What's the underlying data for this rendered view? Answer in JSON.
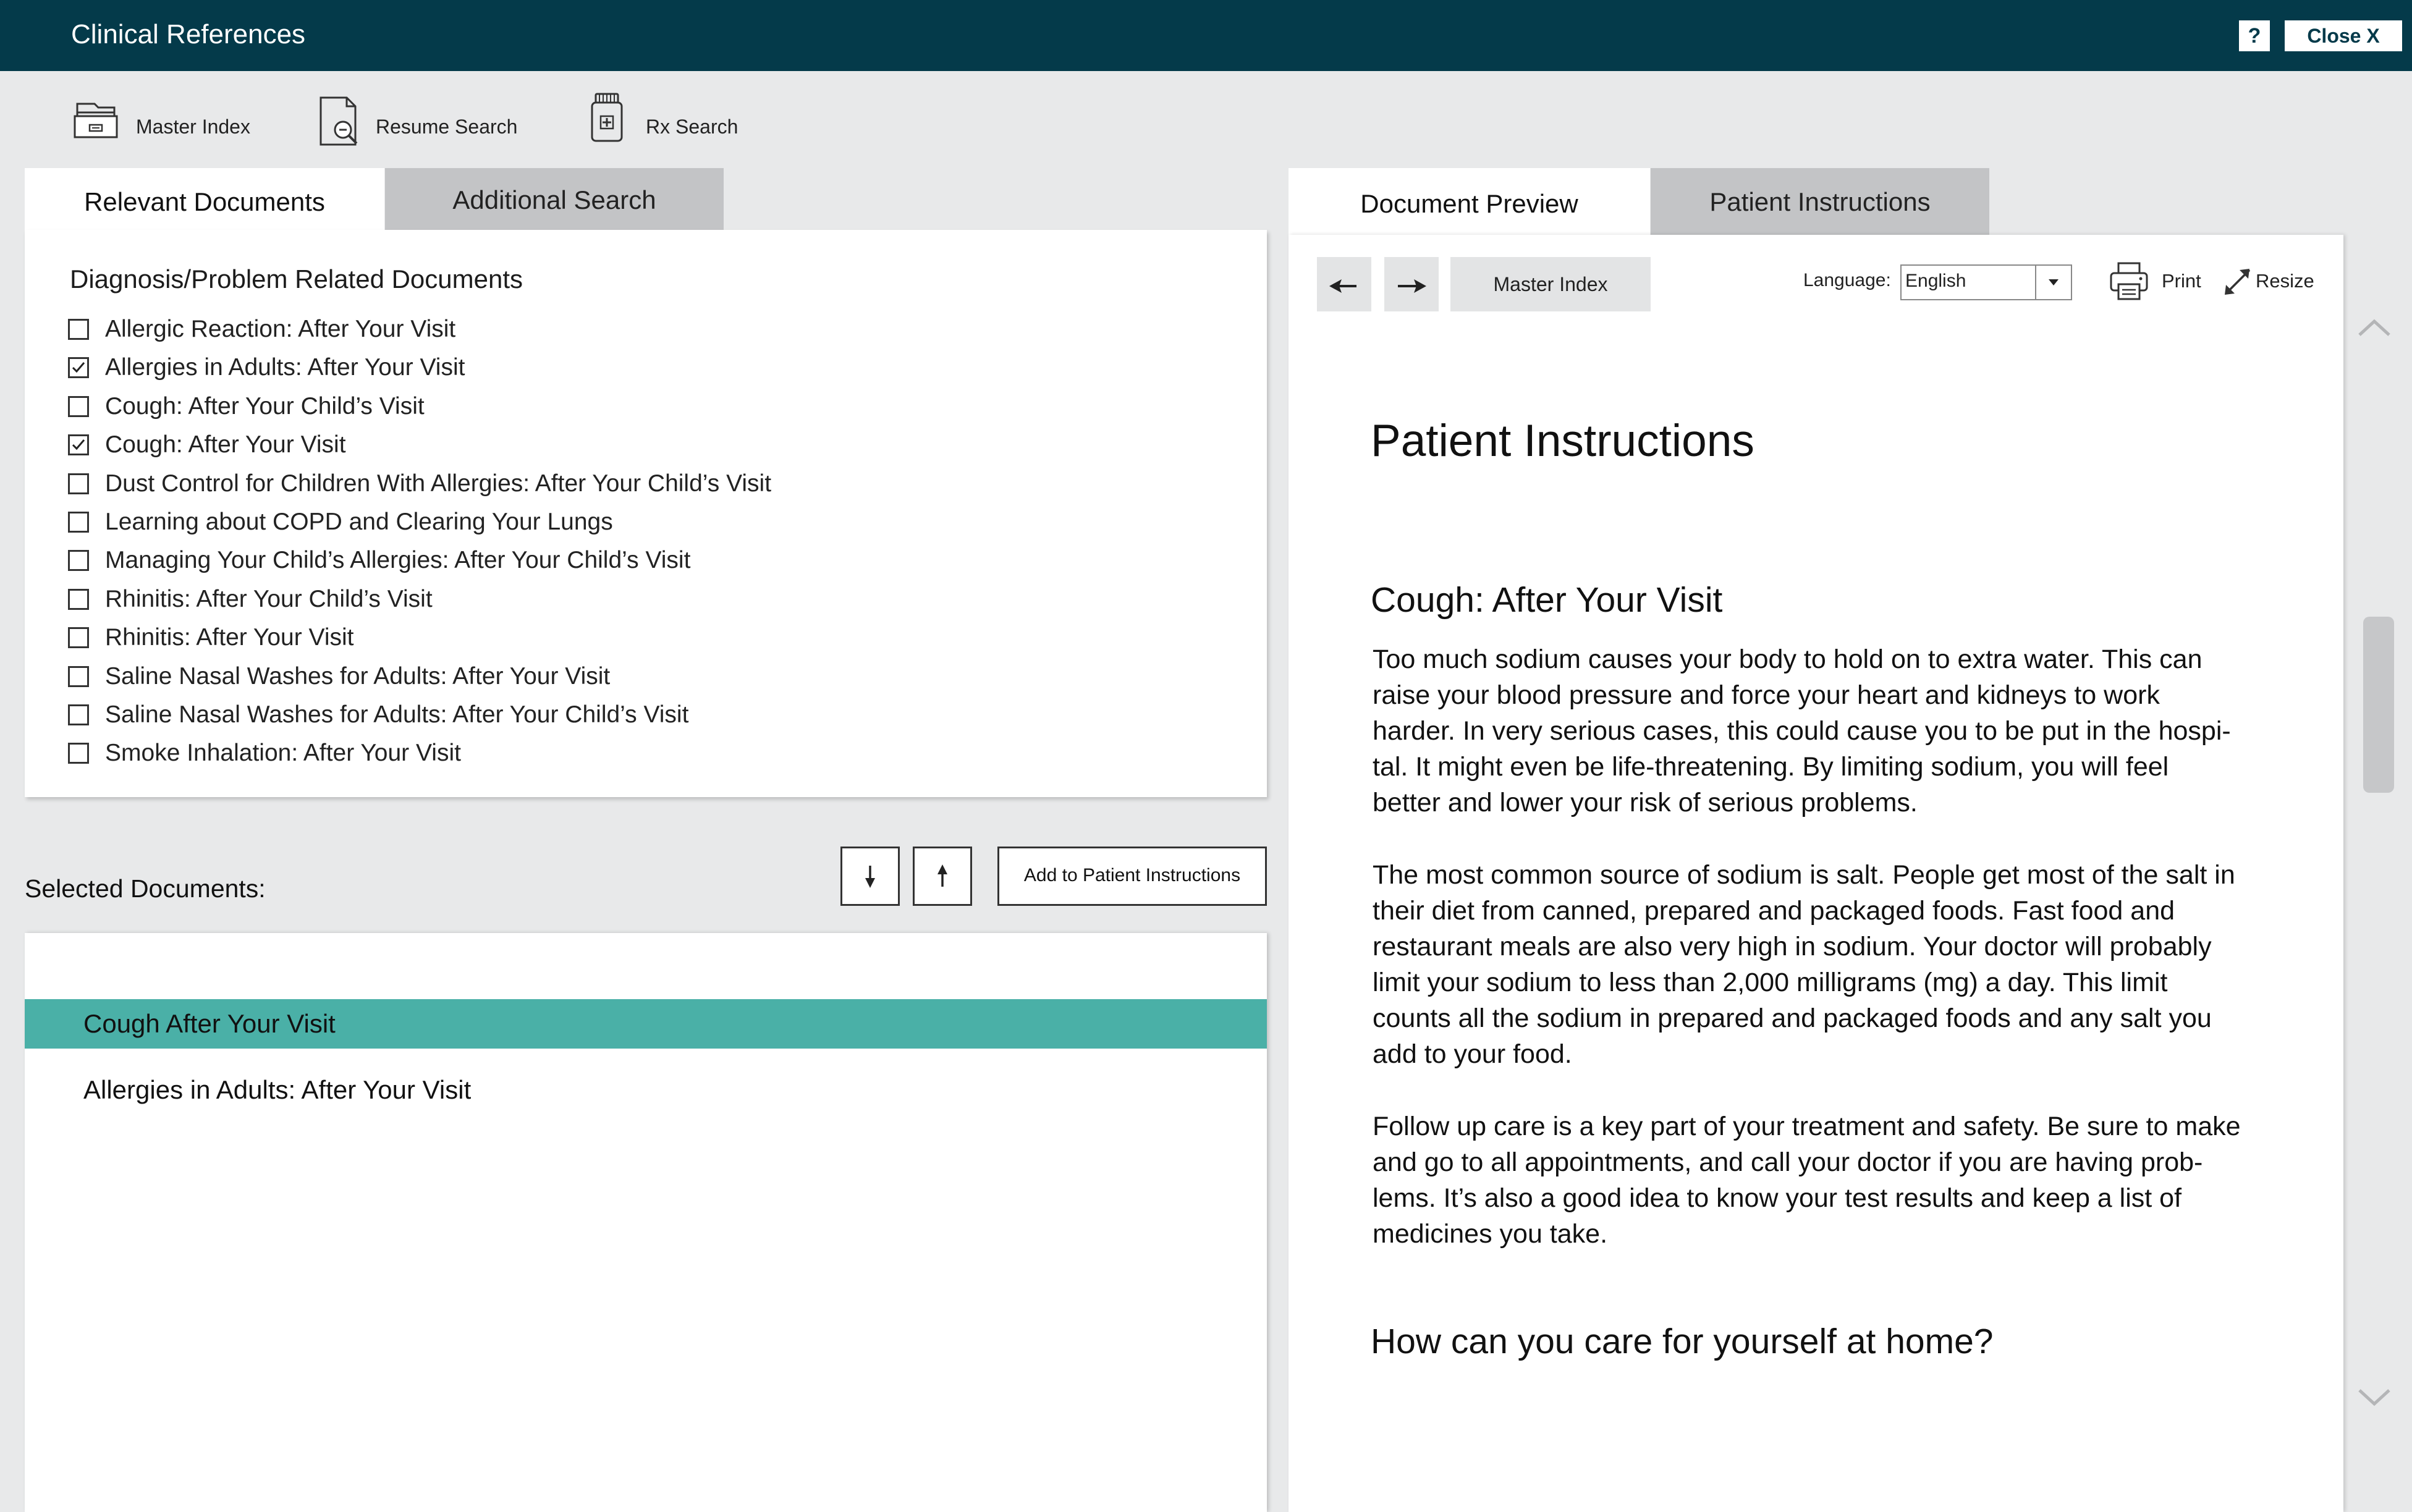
{
  "app": {
    "title": "Clinical References",
    "help_label": "?",
    "close_label": "Close   X"
  },
  "toolbar": {
    "items": [
      {
        "label": "Master Index",
        "icon": "folder-icon"
      },
      {
        "label": "Resume Search",
        "icon": "document-search-icon"
      },
      {
        "label": "Rx Search",
        "icon": "pill-bottle-icon"
      }
    ]
  },
  "left_tabs": [
    {
      "label": "Relevant Documents",
      "active": true
    },
    {
      "label": "Additional Search",
      "active": false
    }
  ],
  "relevant": {
    "heading": "Diagnosis/Problem Related Documents",
    "items": [
      {
        "label": "Allergic Reaction: After Your Visit",
        "checked": false
      },
      {
        "label": "Allergies in Adults: After Your Visit",
        "checked": true
      },
      {
        "label": "Cough: After Your Child’s Visit",
        "checked": false
      },
      {
        "label": "Cough: After Your Visit",
        "checked": true
      },
      {
        "label": "Dust Control for Children With Allergies: After Your Child’s Visit",
        "checked": false
      },
      {
        "label": "Learning about COPD and Clearing Your Lungs",
        "checked": false
      },
      {
        "label": "Managing Your Child’s Allergies: After Your Child’s Visit",
        "checked": false
      },
      {
        "label": "Rhinitis: After Your Child’s Visit",
        "checked": false
      },
      {
        "label": "Rhinitis: After Your Visit",
        "checked": false
      },
      {
        "label": "Saline Nasal Washes for Adults: After Your Visit",
        "checked": false
      },
      {
        "label": "Saline Nasal Washes for Adults: After Your Child’s Visit",
        "checked": false
      },
      {
        "label": "Smoke Inhalation: After Your Visit",
        "checked": false
      }
    ]
  },
  "selected": {
    "heading": "Selected Documents:",
    "add_button": "Add to Patient Instructions",
    "items": [
      {
        "label": "Cough After Your Visit",
        "active": true
      },
      {
        "label": "Allergies in Adults: After Your Visit",
        "active": false
      }
    ]
  },
  "right_tabs": [
    {
      "label": "Document Preview",
      "active": true
    },
    {
      "label": "Patient Instructions",
      "active": false
    }
  ],
  "preview": {
    "master_index_label": "Master Index",
    "language_label": "Language:",
    "language_value": "English",
    "print_label": "Print",
    "resize_label": "Resize",
    "title": "Patient Instructions",
    "subtitle": "Cough: After Your Visit",
    "paragraphs": [
      [
        "Too much sodium causes your body to hold on to extra water. This can",
        "raise your blood pressure and force your heart and kidneys to work",
        "harder. In very serious cases, this could cause you to be put in the hospi-",
        "tal. It might even be life-threatening. By limiting sodium, you will feel",
        "better and lower your risk of serious problems."
      ],
      [
        "The most common source of sodium is salt. People get most of the salt in",
        "their diet from canned, prepared and packaged foods. Fast food and",
        "restaurant meals are also very high in sodium. Your doctor will probably",
        "limit your sodium to less than 2,000 milligrams (mg) a day. This limit",
        "counts all the sodium in prepared and packaged foods and any salt you",
        "add to your food."
      ],
      [
        "Follow up care is a key part of your treatment and safety. Be sure to make",
        "and go to all appointments, and call your doctor if you are having prob-",
        "lems. It’s also a good idea to know your test results and keep a list of",
        "medicines you take."
      ]
    ],
    "section_heading": "How can you care for yourself at home?"
  }
}
